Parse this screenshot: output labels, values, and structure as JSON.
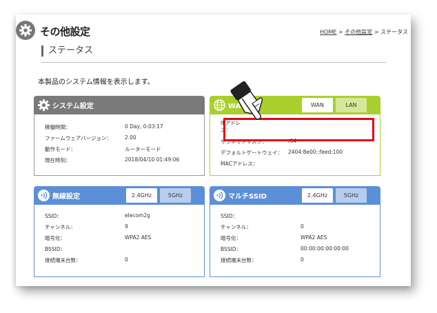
{
  "header": {
    "title": "その他設定",
    "breadcrumb": {
      "home": "HOME",
      "sep1": " > ",
      "parent": "その他設定",
      "sep2": " > ",
      "current": "ステータス"
    }
  },
  "section": {
    "heading": "ステータス",
    "description": "本製品のシステム情報を表示します。"
  },
  "system_panel": {
    "title": "システム設定",
    "rows": [
      {
        "label": "稼働時間：",
        "value": "0 Day, 0:03:17"
      },
      {
        "label": "ファームウェアバージョン：",
        "value": "2.00"
      },
      {
        "label": "動作モード：",
        "value": "ルーターモード"
      },
      {
        "label": "現在時刻：",
        "value": "2018/04/10 01:49:06"
      }
    ]
  },
  "wan_panel": {
    "title": "WAN設定",
    "tabs": [
      "WAN",
      "LAN"
    ],
    "active_tab": "WAN",
    "ip_label_line1": "IPアドレ",
    "ip_label_line2": "ス：",
    "rows": [
      {
        "label": "サブネットマスク：",
        "value": "/64"
      },
      {
        "label": "デフォルトゲートウェイ：",
        "value": "2404:8e00::feed:100"
      },
      {
        "label": "MACアドレス：",
        "value": ""
      }
    ]
  },
  "wireless_panel": {
    "title": "無線設定",
    "tabs": [
      "2.4GHz",
      "5GHz"
    ],
    "active_tab": "2.4GHz",
    "rows": [
      {
        "label": "SSID：",
        "value": "elecom2g"
      },
      {
        "label": "チャンネル：",
        "value": "9"
      },
      {
        "label": "暗号化：",
        "value": "WPA2 AES"
      },
      {
        "label": "BSSID：",
        "value": ""
      },
      {
        "label": "接続端末台数：",
        "value": "0"
      }
    ]
  },
  "multi_panel": {
    "title": "マルチSSID",
    "tabs": [
      "2.4GHz",
      "5GHz"
    ],
    "active_tab": "2.4GHz",
    "rows": [
      {
        "label": "SSID：",
        "value": ""
      },
      {
        "label": "チャンネル：",
        "value": "0"
      },
      {
        "label": "暗号化：",
        "value": "WPA2 AES"
      },
      {
        "label": "BSSID：",
        "value": "00:00:00:00:00:00"
      },
      {
        "label": "接続端末台数：",
        "value": "0"
      }
    ]
  },
  "colors": {
    "system_header": "#7a7a7a",
    "wan_header": "#a9cf2c",
    "wireless_header": "#5b8fd8",
    "highlight": "#e2001a"
  }
}
